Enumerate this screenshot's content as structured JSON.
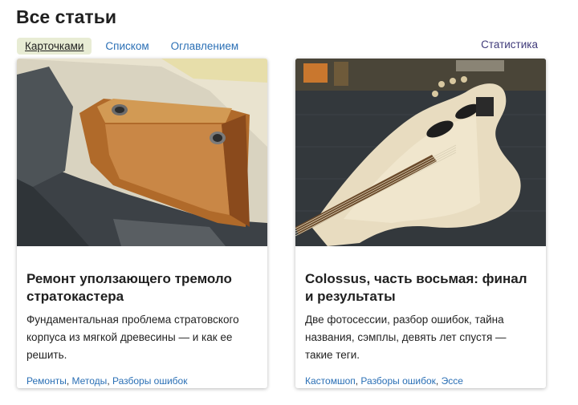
{
  "page": {
    "title": "Все статьи"
  },
  "view_tabs": [
    {
      "label": "Карточками",
      "active": true
    },
    {
      "label": "Списком",
      "active": false
    },
    {
      "label": "Оглавлением",
      "active": false
    }
  ],
  "stats_link": "Статистика",
  "cards": [
    {
      "title": "Ремонт уползающего тремоло стратокастера",
      "description": "Фундаментальная проблема стратовского корпуса из мягкой древесины — и как ее решить.",
      "tags": [
        "Ремонты",
        "Методы",
        "Разборы ошибок"
      ]
    },
    {
      "title": "Colossus, часть восьмая: финал и результаты",
      "description": "Две фотосессии, разбор ошибок, тайна названия, сэмплы, девять лет спустя — такие теги.",
      "tags": [
        "Кастомшоп",
        "Разборы ошибок",
        "Эссе"
      ]
    }
  ],
  "colors": {
    "link": "#2a6fb5",
    "active_tab_bg": "#e8ecd4",
    "stats_link": "#3f3a7a"
  }
}
